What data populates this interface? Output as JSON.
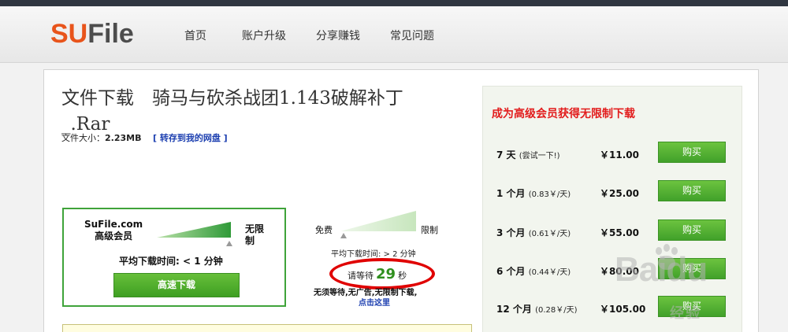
{
  "header": {
    "logo_su": "SU",
    "logo_file": "File",
    "nav": [
      "首页",
      "账户升级",
      "分享赚钱",
      "常见问题"
    ]
  },
  "file": {
    "title": "文件下载　骑马与砍杀战团1.143破解补丁_.Rar",
    "size_label": "文件大小：",
    "size_value": "2.23MB",
    "save_link": "[ 转存到我的网盘 ]"
  },
  "premium": {
    "brand_line1": "SuFile.com",
    "brand_line2": "高级会员",
    "unlimited": "无限制",
    "avg_time": "平均下载时间: < 1 分钟",
    "button": "高速下载"
  },
  "free": {
    "free_label": "免费",
    "limit_label": "限制",
    "avg_time": "平均下载时间: > 2 分钟",
    "wait_prefix": "请等待",
    "wait_seconds": "29",
    "wait_suffix": "秒",
    "no_wait": "无须等待,无广告,无限制下载,",
    "click_here": "点击这里"
  },
  "sidebar": {
    "heading": "成为高级会员获得无限制下载",
    "plans": [
      {
        "name": "7 天",
        "note": "(尝试一下!)",
        "price": "￥11.00",
        "button": "购买"
      },
      {
        "name": "1 个月",
        "note": "(0.83￥/天)",
        "price": "￥25.00",
        "button": "购买"
      },
      {
        "name": "3 个月",
        "note": "(0.61￥/天)",
        "price": "￥55.00",
        "button": "购买"
      },
      {
        "name": "6 个月",
        "note": "(0.44￥/天)",
        "price": "￥80.00",
        "button": "购买"
      },
      {
        "name": "12 个月",
        "note": "(0.28￥/天)",
        "price": "￥105.00",
        "button": "购买"
      }
    ]
  },
  "watermark": {
    "text": "Baidu",
    "sub": "经验"
  },
  "colors": {
    "brand_orange": "#e8541b",
    "green_button": "#4aa82a",
    "red_heading": "#e21b1b",
    "link_blue": "#1c3fb0"
  }
}
